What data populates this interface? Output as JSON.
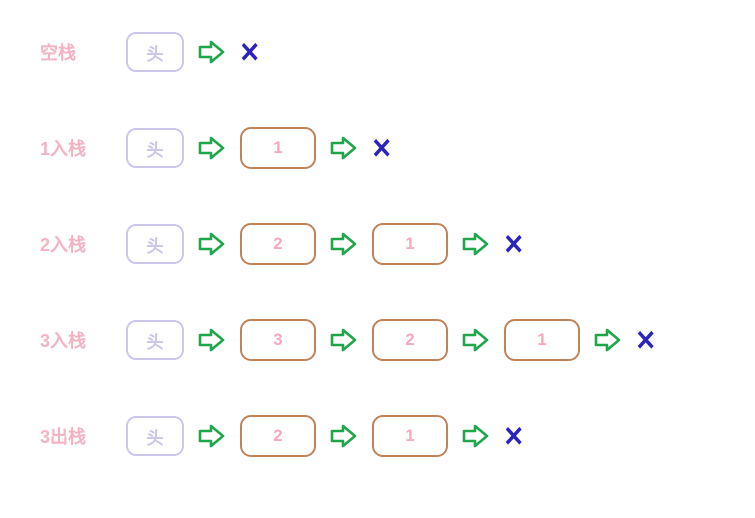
{
  "head_label": "头",
  "terminator": "✕",
  "rows": [
    {
      "label": "空栈",
      "nodes": []
    },
    {
      "label": "1入栈",
      "nodes": [
        "1"
      ]
    },
    {
      "label": "2入栈",
      "nodes": [
        "2",
        "1"
      ]
    },
    {
      "label": "3入栈",
      "nodes": [
        "3",
        "2",
        "1"
      ]
    },
    {
      "label": "3出栈",
      "nodes": [
        "2",
        "1"
      ]
    }
  ],
  "colors": {
    "label": "#f4b2c3",
    "head_border": "#cfc6ee",
    "head_text": "#ccc3eb",
    "node_border": "#c1835a",
    "node_text": "#f4a9bd",
    "arrow_stroke": "#1ea64a",
    "terminator": "#2a24bd"
  }
}
